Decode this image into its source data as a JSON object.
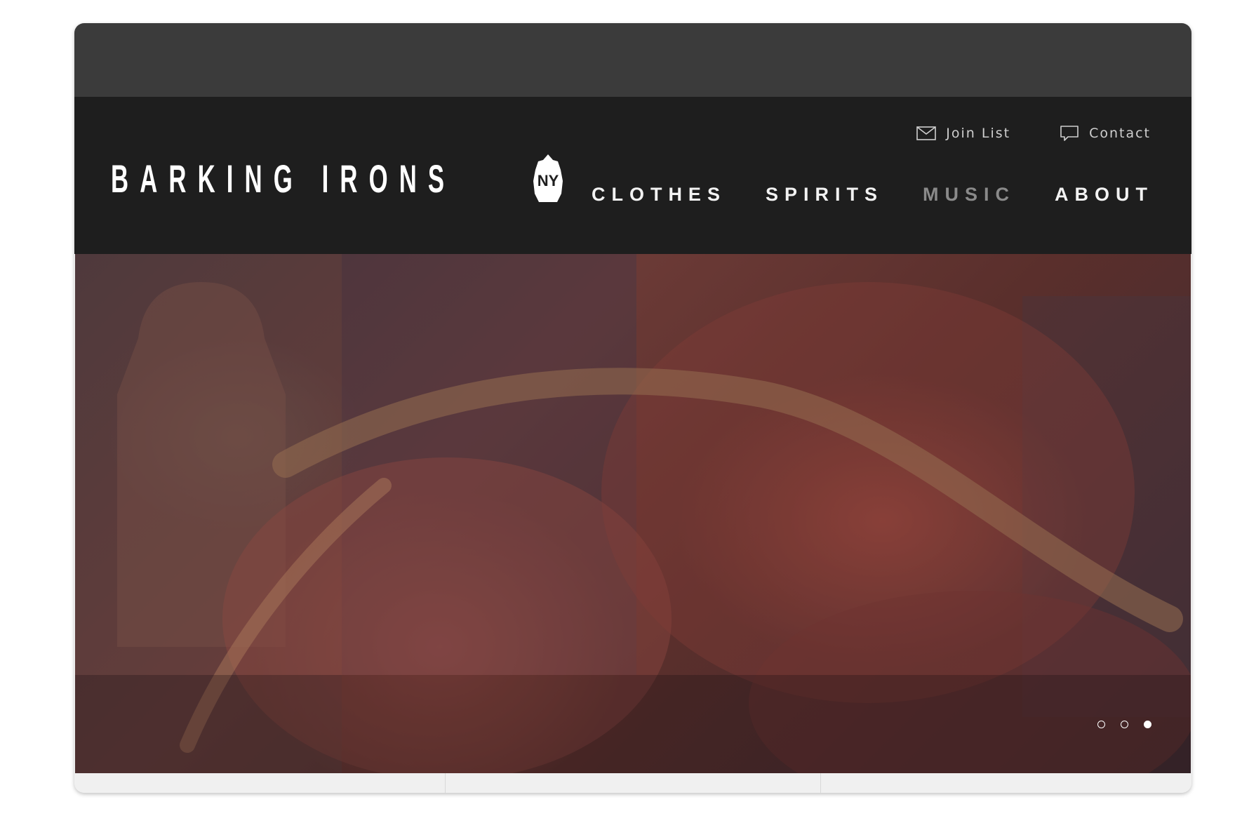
{
  "header": {
    "logo_text": "BARKING IRONS",
    "logo_badge": "NY",
    "utility_links": [
      {
        "label": "Join List",
        "icon": "envelope-icon"
      },
      {
        "label": "Contact",
        "icon": "speech-bubble-icon"
      }
    ],
    "nav": [
      {
        "label": "CLOTHES",
        "active": false
      },
      {
        "label": "SPIRITS",
        "active": false
      },
      {
        "label": "MUSIC",
        "active": true
      },
      {
        "label": "ABOUT",
        "active": false
      }
    ]
  },
  "hero": {
    "slides_total": 3,
    "active_slide": 3
  },
  "colors": {
    "topbar": "#3b3b3b",
    "header": "#1e1e1e",
    "nav_active": "#8a8a8a",
    "page_bg": "#ffffff"
  }
}
